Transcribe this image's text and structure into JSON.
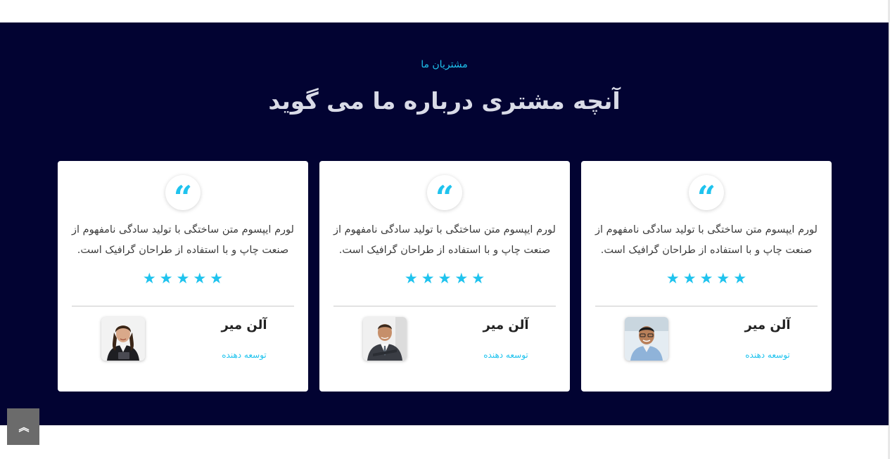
{
  "testimonials_section": {
    "kicker": "مشتریان ما",
    "heading": "آنچه مشتری درباره ما می گوید",
    "accent_color": "#1fc3ee",
    "background_color": "#020332",
    "cards": [
      {
        "quote_icon": "quote-icon",
        "quote_mark": "“",
        "text": "لورم ایپسوم متن ساختگی با تولید سادگی نامفهوم از صنعت چاپ و با استفاده از طراحان گرافیک است.",
        "rating": 5,
        "star_glyph": "★",
        "name": "آلن میر",
        "role": "توسعه دهنده",
        "avatar": "man-with-glasses-photo"
      },
      {
        "quote_icon": "quote-icon",
        "quote_mark": "“",
        "text": "لورم ایپسوم متن ساختگی با تولید سادگی نامفهوم از صنعت چاپ و با استفاده از طراحان گرافیک است.",
        "rating": 5,
        "star_glyph": "★",
        "name": "آلن میر",
        "role": "توسعه دهنده",
        "avatar": "man-in-suit-photo"
      },
      {
        "quote_icon": "quote-icon",
        "quote_mark": "“",
        "text": "لورم ایپسوم متن ساختگی با تولید سادگی نامفهوم از صنعت چاپ و با استفاده از طراحان گرافیک است.",
        "rating": 5,
        "star_glyph": "★",
        "name": "آلن میر",
        "role": "توسعه دهنده",
        "avatar": "woman-with-tablet-photo"
      }
    ]
  },
  "scroll_top": {
    "icon": "double-chevron-up-icon",
    "glyph": "︽"
  }
}
